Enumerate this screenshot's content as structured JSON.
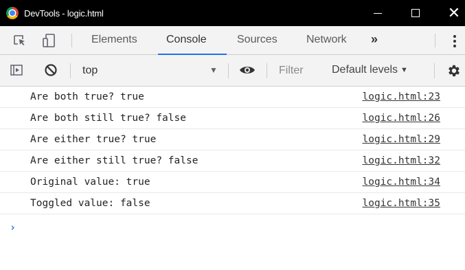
{
  "window": {
    "title": "DevTools - logic.html",
    "close_glyph": "✕"
  },
  "tabs": [
    {
      "label": "Elements"
    },
    {
      "label": "Console",
      "active": true
    },
    {
      "label": "Sources"
    },
    {
      "label": "Network"
    }
  ],
  "more_tabs_glyph": "»",
  "toolbar": {
    "context": "top",
    "context_arrow": "▼",
    "filter_placeholder": "Filter",
    "levels_label": "Default levels",
    "levels_arrow": "▼"
  },
  "messages": [
    {
      "text": "Are both true? true",
      "source": "logic.html:23"
    },
    {
      "text": "Are both still true? false",
      "source": "logic.html:26"
    },
    {
      "text": "Are either true? true",
      "source": "logic.html:29"
    },
    {
      "text": "Are either still true? false",
      "source": "logic.html:32"
    },
    {
      "text": "Original value: true",
      "source": "logic.html:34"
    },
    {
      "text": "Toggled value: false",
      "source": "logic.html:35"
    }
  ],
  "prompt_glyph": "›",
  "colors": {
    "titlebar": "#000000",
    "active_tab_underline": "#1a73e8",
    "prompt": "#1a73e8"
  }
}
